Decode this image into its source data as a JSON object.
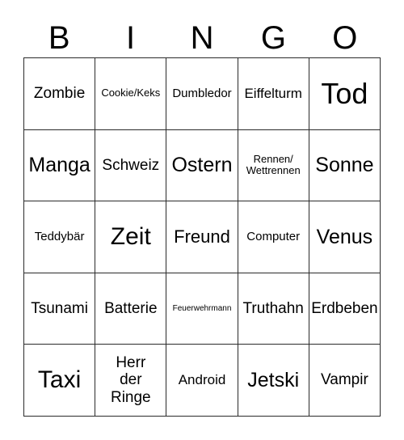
{
  "card": {
    "title": "BINGO",
    "header_letters": [
      "B",
      "I",
      "N",
      "G",
      "O"
    ],
    "grid_size": "5x5",
    "colors": {
      "background": "#ffffff",
      "border": "#2b2b2b",
      "text": "#000000"
    },
    "cells": [
      [
        {
          "text": "Zombie",
          "size": "ml"
        },
        {
          "text": "Cookie/Keks",
          "size": "xs"
        },
        {
          "text": "Dumbledor",
          "size": "s"
        },
        {
          "text": "Eiffelturm",
          "size": "m"
        },
        {
          "text": "Tod",
          "size": "h"
        }
      ],
      [
        {
          "text": "Manga",
          "size": "xl"
        },
        {
          "text": "Schweiz",
          "size": "ml"
        },
        {
          "text": "Ostern",
          "size": "xl"
        },
        {
          "text": "Rennen/\nWettrennen",
          "size": "xs"
        },
        {
          "text": "Sonne",
          "size": "xl"
        }
      ],
      [
        {
          "text": "Teddybär",
          "size": "s"
        },
        {
          "text": "Zeit",
          "size": "xxl"
        },
        {
          "text": "Freund",
          "size": "l"
        },
        {
          "text": "Computer",
          "size": "s"
        },
        {
          "text": "Venus",
          "size": "xl"
        }
      ],
      [
        {
          "text": "Tsunami",
          "size": "ml"
        },
        {
          "text": "Batterie",
          "size": "ml"
        },
        {
          "text": "Feuerwehrmann",
          "size": "xxs"
        },
        {
          "text": "Truthahn",
          "size": "ml"
        },
        {
          "text": "Erdbeben",
          "size": "ml"
        }
      ],
      [
        {
          "text": "Taxi",
          "size": "xxl"
        },
        {
          "text": "Herr\nder\nRinge",
          "size": "ml"
        },
        {
          "text": "Android",
          "size": "m"
        },
        {
          "text": "Jetski",
          "size": "xl"
        },
        {
          "text": "Vampir",
          "size": "ml"
        }
      ]
    ]
  }
}
